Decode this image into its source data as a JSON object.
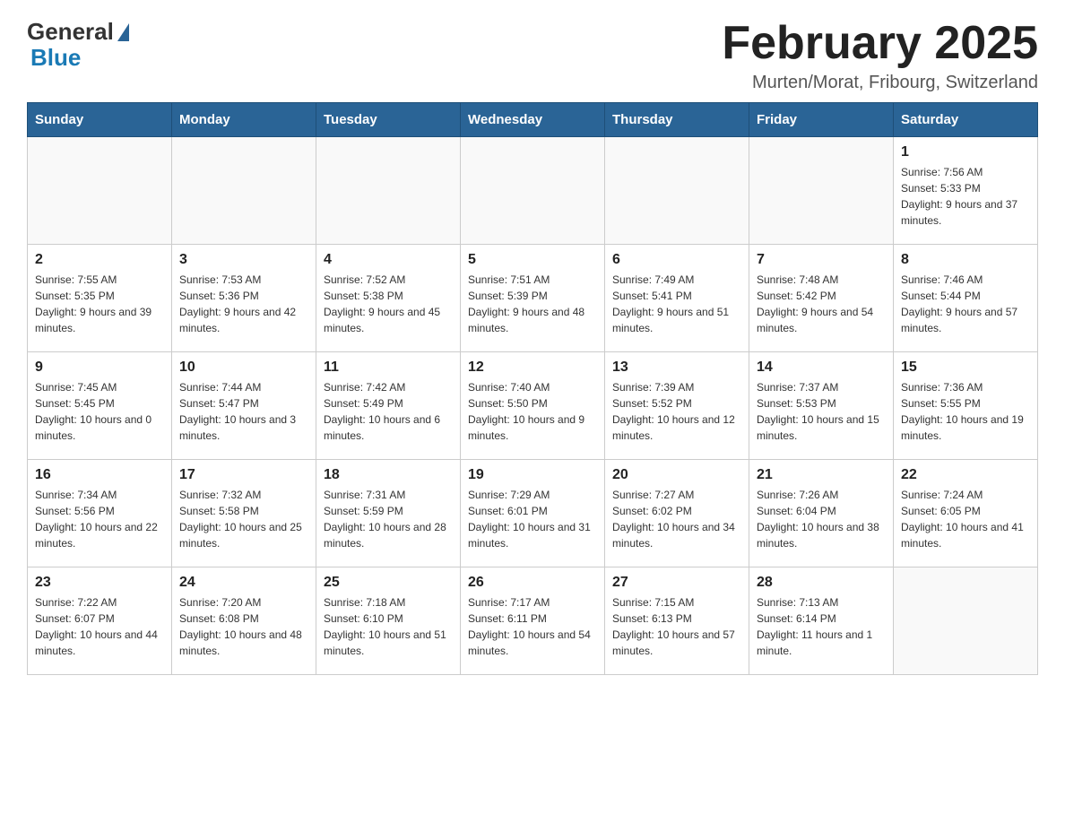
{
  "header": {
    "logo_general": "General",
    "logo_blue": "Blue",
    "month_title": "February 2025",
    "location": "Murten/Morat, Fribourg, Switzerland"
  },
  "days_of_week": [
    "Sunday",
    "Monday",
    "Tuesday",
    "Wednesday",
    "Thursday",
    "Friday",
    "Saturday"
  ],
  "weeks": [
    [
      {
        "day": "",
        "info": ""
      },
      {
        "day": "",
        "info": ""
      },
      {
        "day": "",
        "info": ""
      },
      {
        "day": "",
        "info": ""
      },
      {
        "day": "",
        "info": ""
      },
      {
        "day": "",
        "info": ""
      },
      {
        "day": "1",
        "info": "Sunrise: 7:56 AM\nSunset: 5:33 PM\nDaylight: 9 hours and 37 minutes."
      }
    ],
    [
      {
        "day": "2",
        "info": "Sunrise: 7:55 AM\nSunset: 5:35 PM\nDaylight: 9 hours and 39 minutes."
      },
      {
        "day": "3",
        "info": "Sunrise: 7:53 AM\nSunset: 5:36 PM\nDaylight: 9 hours and 42 minutes."
      },
      {
        "day": "4",
        "info": "Sunrise: 7:52 AM\nSunset: 5:38 PM\nDaylight: 9 hours and 45 minutes."
      },
      {
        "day": "5",
        "info": "Sunrise: 7:51 AM\nSunset: 5:39 PM\nDaylight: 9 hours and 48 minutes."
      },
      {
        "day": "6",
        "info": "Sunrise: 7:49 AM\nSunset: 5:41 PM\nDaylight: 9 hours and 51 minutes."
      },
      {
        "day": "7",
        "info": "Sunrise: 7:48 AM\nSunset: 5:42 PM\nDaylight: 9 hours and 54 minutes."
      },
      {
        "day": "8",
        "info": "Sunrise: 7:46 AM\nSunset: 5:44 PM\nDaylight: 9 hours and 57 minutes."
      }
    ],
    [
      {
        "day": "9",
        "info": "Sunrise: 7:45 AM\nSunset: 5:45 PM\nDaylight: 10 hours and 0 minutes."
      },
      {
        "day": "10",
        "info": "Sunrise: 7:44 AM\nSunset: 5:47 PM\nDaylight: 10 hours and 3 minutes."
      },
      {
        "day": "11",
        "info": "Sunrise: 7:42 AM\nSunset: 5:49 PM\nDaylight: 10 hours and 6 minutes."
      },
      {
        "day": "12",
        "info": "Sunrise: 7:40 AM\nSunset: 5:50 PM\nDaylight: 10 hours and 9 minutes."
      },
      {
        "day": "13",
        "info": "Sunrise: 7:39 AM\nSunset: 5:52 PM\nDaylight: 10 hours and 12 minutes."
      },
      {
        "day": "14",
        "info": "Sunrise: 7:37 AM\nSunset: 5:53 PM\nDaylight: 10 hours and 15 minutes."
      },
      {
        "day": "15",
        "info": "Sunrise: 7:36 AM\nSunset: 5:55 PM\nDaylight: 10 hours and 19 minutes."
      }
    ],
    [
      {
        "day": "16",
        "info": "Sunrise: 7:34 AM\nSunset: 5:56 PM\nDaylight: 10 hours and 22 minutes."
      },
      {
        "day": "17",
        "info": "Sunrise: 7:32 AM\nSunset: 5:58 PM\nDaylight: 10 hours and 25 minutes."
      },
      {
        "day": "18",
        "info": "Sunrise: 7:31 AM\nSunset: 5:59 PM\nDaylight: 10 hours and 28 minutes."
      },
      {
        "day": "19",
        "info": "Sunrise: 7:29 AM\nSunset: 6:01 PM\nDaylight: 10 hours and 31 minutes."
      },
      {
        "day": "20",
        "info": "Sunrise: 7:27 AM\nSunset: 6:02 PM\nDaylight: 10 hours and 34 minutes."
      },
      {
        "day": "21",
        "info": "Sunrise: 7:26 AM\nSunset: 6:04 PM\nDaylight: 10 hours and 38 minutes."
      },
      {
        "day": "22",
        "info": "Sunrise: 7:24 AM\nSunset: 6:05 PM\nDaylight: 10 hours and 41 minutes."
      }
    ],
    [
      {
        "day": "23",
        "info": "Sunrise: 7:22 AM\nSunset: 6:07 PM\nDaylight: 10 hours and 44 minutes."
      },
      {
        "day": "24",
        "info": "Sunrise: 7:20 AM\nSunset: 6:08 PM\nDaylight: 10 hours and 48 minutes."
      },
      {
        "day": "25",
        "info": "Sunrise: 7:18 AM\nSunset: 6:10 PM\nDaylight: 10 hours and 51 minutes."
      },
      {
        "day": "26",
        "info": "Sunrise: 7:17 AM\nSunset: 6:11 PM\nDaylight: 10 hours and 54 minutes."
      },
      {
        "day": "27",
        "info": "Sunrise: 7:15 AM\nSunset: 6:13 PM\nDaylight: 10 hours and 57 minutes."
      },
      {
        "day": "28",
        "info": "Sunrise: 7:13 AM\nSunset: 6:14 PM\nDaylight: 11 hours and 1 minute."
      },
      {
        "day": "",
        "info": ""
      }
    ]
  ]
}
